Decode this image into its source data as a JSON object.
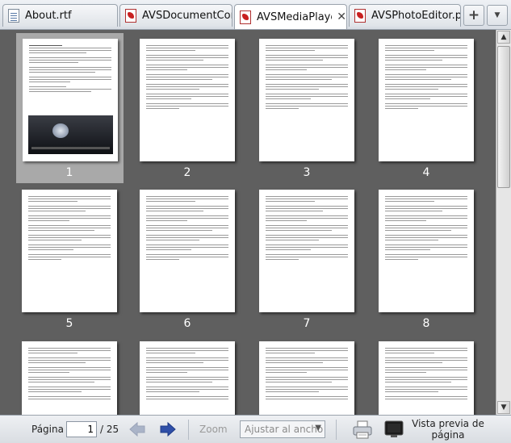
{
  "tabs": [
    {
      "label": "About.rtf",
      "icon": "rtf-document-icon",
      "active": false
    },
    {
      "label": "AVSDocumentConve…",
      "icon": "pdf-document-icon",
      "active": false
    },
    {
      "label": "AVSMediaPlayer.…",
      "icon": "pdf-document-icon",
      "active": true
    },
    {
      "label": "AVSPhotoEditor.pdf",
      "icon": "pdf-document-icon",
      "active": false
    }
  ],
  "tab_close_glyph": "✕",
  "add_tab_glyph": "+",
  "tab_menu_glyph": "▼",
  "pages": [
    "1",
    "2",
    "3",
    "4",
    "5",
    "6",
    "7",
    "8",
    "",
    "",
    "",
    ""
  ],
  "selected_page": 1,
  "bottom": {
    "page_label": "Página",
    "current_page": "1",
    "total_pages": "/ 25",
    "zoom_label": "Zoom",
    "zoom_value": "Ajustar al ancho",
    "preview_label_1": "Vista previa de",
    "preview_label_2": "página"
  },
  "scroll": {
    "up": "▲",
    "down": "▼"
  }
}
